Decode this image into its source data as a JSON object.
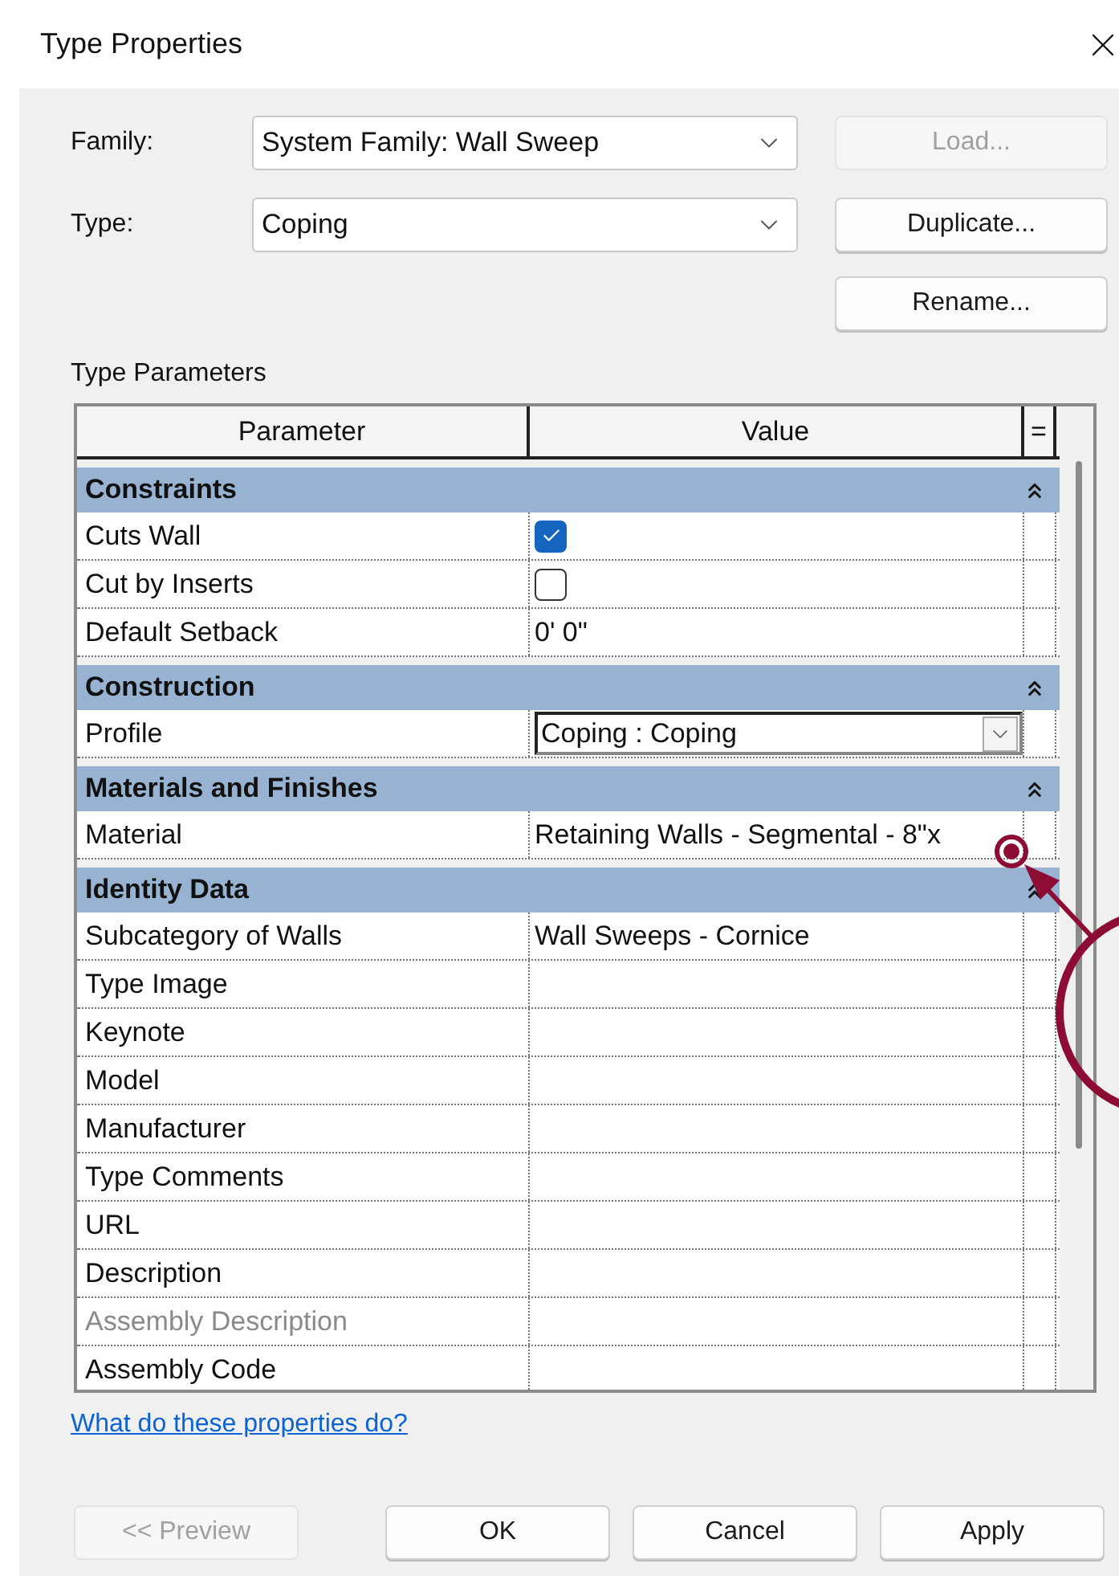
{
  "window": {
    "title": "Type Properties"
  },
  "family": {
    "label": "Family:",
    "value": "System Family: Wall Sweep"
  },
  "type": {
    "label": "Type:",
    "value": "Coping"
  },
  "side_buttons": [
    {
      "label": "Load...",
      "disabled": true
    },
    {
      "label": "Duplicate...",
      "disabled": false
    },
    {
      "label": "Rename...",
      "disabled": false
    }
  ],
  "section_label": "Type Parameters",
  "table": {
    "columns": [
      "Parameter",
      "Value",
      "="
    ],
    "groups": [
      {
        "title": "Constraints",
        "expanded": true,
        "rows": [
          {
            "kind": "checkbox",
            "name": "Cuts Wall",
            "checked": true,
            "disabled": false
          },
          {
            "kind": "checkbox",
            "name": "Cut by Inserts",
            "checked": false,
            "disabled": false
          },
          {
            "kind": "text",
            "name": "Default Setback",
            "value": "0'  0\"",
            "disabled": false
          }
        ]
      },
      {
        "title": "Construction",
        "expanded": true,
        "rows": [
          {
            "kind": "dropdown",
            "name": "Profile",
            "value": "Coping : Coping",
            "disabled": false
          }
        ]
      },
      {
        "title": "Materials and Finishes",
        "expanded": true,
        "rows": [
          {
            "kind": "text",
            "name": "Material",
            "value": "Retaining Walls - Segmental - 8\"x",
            "disabled": false
          }
        ]
      },
      {
        "title": "Identity Data",
        "expanded": true,
        "rows": [
          {
            "kind": "text",
            "name": "Subcategory of Walls",
            "value": "Wall Sweeps - Cornice",
            "disabled": false
          },
          {
            "kind": "text",
            "name": "Type Image",
            "disabled": false
          },
          {
            "kind": "text",
            "name": "Keynote",
            "disabled": false
          },
          {
            "kind": "text",
            "name": "Model",
            "disabled": false
          },
          {
            "kind": "text",
            "name": "Manufacturer",
            "disabled": false
          },
          {
            "kind": "text",
            "name": "Type Comments",
            "disabled": false
          },
          {
            "kind": "text",
            "name": "URL",
            "disabled": false
          },
          {
            "kind": "text",
            "name": "Description",
            "disabled": false
          },
          {
            "kind": "text",
            "name": "Assembly Description",
            "disabled": true
          },
          {
            "kind": "text",
            "name": "Assembly Code",
            "disabled": false
          }
        ]
      }
    ]
  },
  "help_link": "What do these properties do?",
  "footer_buttons": [
    {
      "label": "<< Preview",
      "disabled": true
    },
    {
      "label": "OK",
      "disabled": false
    },
    {
      "label": "Cancel",
      "disabled": false
    },
    {
      "label": "Apply",
      "disabled": false
    }
  ]
}
